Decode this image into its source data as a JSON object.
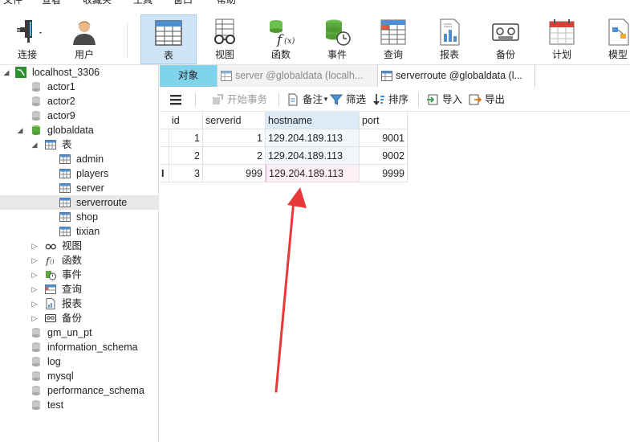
{
  "menubar": {
    "items": [
      "文件",
      "查看",
      "收藏夹",
      "工具",
      "窗口",
      "帮助"
    ]
  },
  "toolbar": {
    "items": [
      {
        "label": "连接",
        "icon": "connection-icon"
      },
      {
        "label": "用户",
        "icon": "user-icon"
      },
      {
        "label": "表",
        "icon": "table-icon"
      },
      {
        "label": "视图",
        "icon": "view-icon"
      },
      {
        "label": "函数",
        "icon": "function-icon"
      },
      {
        "label": "事件",
        "icon": "event-icon"
      },
      {
        "label": "查询",
        "icon": "query-icon"
      },
      {
        "label": "报表",
        "icon": "report-icon"
      },
      {
        "label": "备份",
        "icon": "backup-icon"
      },
      {
        "label": "计划",
        "icon": "schedule-icon"
      },
      {
        "label": "模型",
        "icon": "model-icon"
      }
    ]
  },
  "tree": {
    "connection": "localhost_3306",
    "databases_top": [
      "actor1",
      "actor2",
      "actor9"
    ],
    "current_db": "globaldata",
    "tables_folder": "表",
    "tables": [
      "admin",
      "players",
      "server",
      "serverroute",
      "shop",
      "tixian"
    ],
    "selected_table": "serverroute",
    "folders": [
      "视图",
      "函数",
      "事件",
      "查询",
      "报表",
      "备份"
    ],
    "databases_bottom": [
      "gm_un_pt",
      "information_schema",
      "log",
      "mysql",
      "performance_schema",
      "test"
    ]
  },
  "tabs": {
    "objects": "对象",
    "tab1": "server @globaldata (localh...",
    "tab2": "serverroute @globaldata (l..."
  },
  "datatools": {
    "begin_transaction": "开始事务",
    "note": "备注",
    "filter": "筛选",
    "sort": "排序",
    "import": "导入",
    "export": "导出"
  },
  "grid": {
    "columns": [
      "id",
      "serverid",
      "hostname",
      "port"
    ],
    "rows": [
      [
        "1",
        "1",
        "129.204.189.113",
        "9001"
      ],
      [
        "2",
        "2",
        "129.204.189.113",
        "9002"
      ],
      [
        "3",
        "999",
        "129.204.189.113",
        "9999"
      ]
    ]
  },
  "colors": {
    "accent_tab": "#7fd3ec",
    "active_tool": "#cfe4f7",
    "annotation_arrow": "#e8393a"
  }
}
